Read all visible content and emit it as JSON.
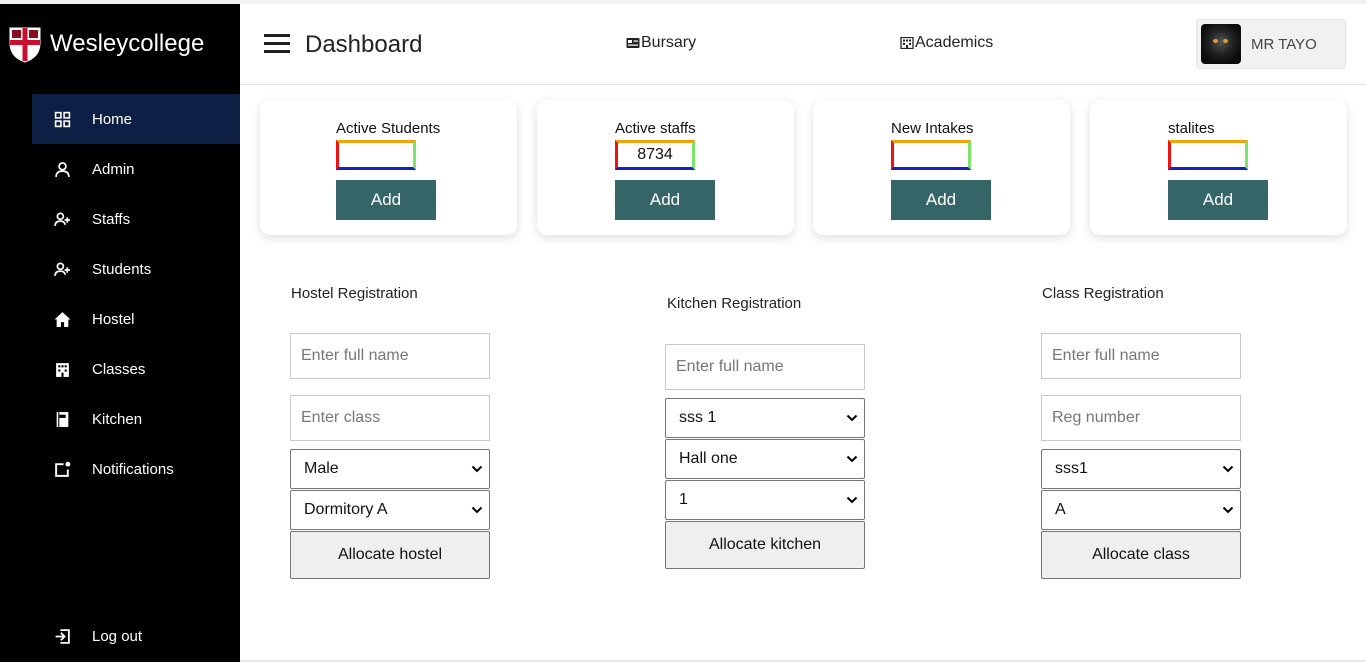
{
  "brand": {
    "name": "Wesleycollege"
  },
  "sidebar": {
    "items": [
      {
        "label": "Home",
        "icon": "grid-icon",
        "active": true
      },
      {
        "label": "Admin",
        "icon": "user-icon"
      },
      {
        "label": "Staffs",
        "icon": "user-plus-icon"
      },
      {
        "label": "Students",
        "icon": "user-plus-icon"
      },
      {
        "label": "Hostel",
        "icon": "house-icon"
      },
      {
        "label": "Classes",
        "icon": "building-icon"
      },
      {
        "label": "Kitchen",
        "icon": "book-icon"
      },
      {
        "label": "Notifications",
        "icon": "notification-icon"
      }
    ],
    "logout": {
      "label": "Log out",
      "icon": "logout-icon"
    }
  },
  "header": {
    "title": "Dashboard",
    "links": [
      {
        "label": "Bursary",
        "icon": "id-card-icon"
      },
      {
        "label": "Academics",
        "icon": "building-icon"
      }
    ],
    "user": {
      "name": "MR TAYO"
    }
  },
  "cards": [
    {
      "label": "Active Students",
      "value": "",
      "button": "Add"
    },
    {
      "label": "Active staffs",
      "value": "8734",
      "button": "Add"
    },
    {
      "label": "New Intakes",
      "value": "",
      "button": "Add"
    },
    {
      "label": "stalites",
      "value": "",
      "button": "Add"
    }
  ],
  "forms": {
    "hostel": {
      "title": "Hostel Registration",
      "name_placeholder": "Enter full name",
      "class_placeholder": "Enter class",
      "gender": "Male",
      "dormitory": "Dormitory A",
      "button": "Allocate hostel"
    },
    "kitchen": {
      "title": "Kitchen Registration",
      "name_placeholder": "Enter full name",
      "class": "sss 1",
      "hall": "Hall one",
      "number": "1",
      "button": "Allocate kitchen"
    },
    "class": {
      "title": "Class Registration",
      "name_placeholder": "Enter full name",
      "reg_placeholder": "Reg number",
      "class": "sss1",
      "arm": "A",
      "button": "Allocate class"
    }
  },
  "colors": {
    "sidebar_bg": "#000000",
    "active_item_bg": "#0d1f45",
    "add_button_bg": "#356566",
    "input_border_top": "#f5a20a",
    "input_border_left": "#ee1111",
    "input_border_right": "#7ce46a",
    "input_border_bottom": "#1322c6"
  }
}
